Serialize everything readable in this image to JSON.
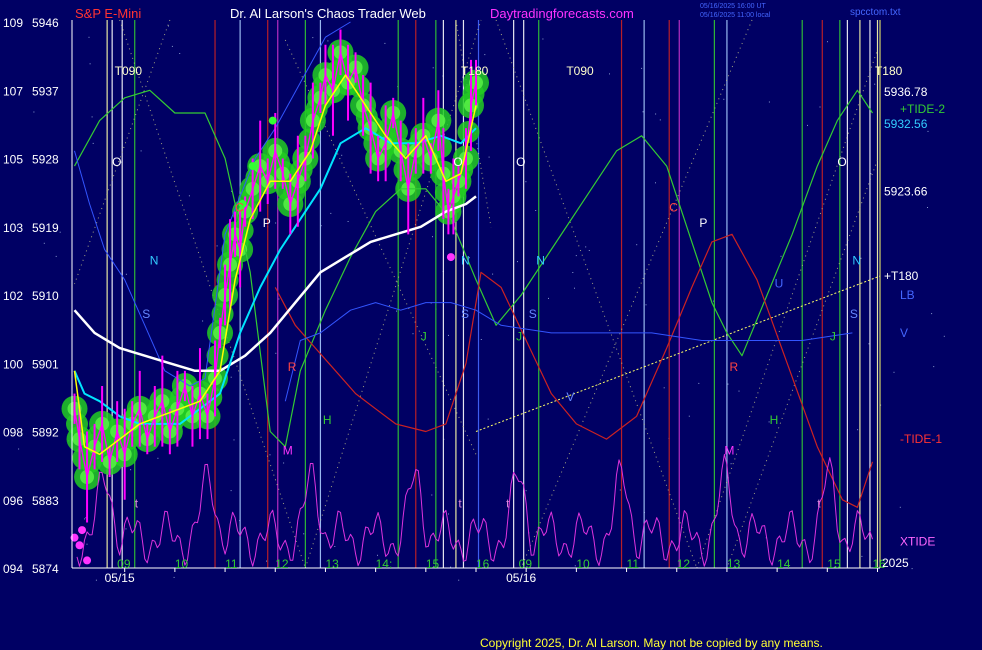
{
  "header": {
    "symbol": "S&P E-Mini",
    "title": "Dr. Al Larson's Chaos Trader Web",
    "site": "Daytradingforecasts.com",
    "timestamp1": "05/16/2025 16:00 UT",
    "timestamp2": "05/16/2025 11:00 local",
    "file": "spcctom.txt"
  },
  "footer": {
    "copyright": "Copyright 2025, Dr. Al Larson. May not be copied by any means."
  },
  "colors": {
    "background": "#000064",
    "price_bars": "#ff00ff",
    "ema_fast": "#ffff00",
    "ema_mid": "#00e5ff",
    "ema_slow": "#ffffff",
    "tide_plus": "#33cc33",
    "tide_minus": "#cc2222",
    "xtide": "#dd33dd",
    "trendline": "#ffff66",
    "glow": "#22cc22"
  },
  "chart_data": {
    "type": "line",
    "y_left_outer": [
      "109",
      "107",
      "105",
      "103",
      "102",
      "100",
      "098",
      "096",
      "094"
    ],
    "y_left_inner": [
      "5946",
      "5937",
      "5928",
      "5919",
      "5910",
      "5901",
      "5892",
      "5883",
      "5874"
    ],
    "ylim": [
      5874,
      5946
    ],
    "x_hour_labels": [
      {
        "t": 8.85,
        "label": "09"
      },
      {
        "t": 10,
        "label": "10"
      },
      {
        "t": 11,
        "label": "11"
      },
      {
        "t": 12,
        "label": "12"
      },
      {
        "t": 13,
        "label": "13"
      },
      {
        "t": 14,
        "label": "14:"
      },
      {
        "t": 15,
        "label": "15"
      },
      {
        "t": 16,
        "label": "16"
      },
      {
        "t": 16.85,
        "label": "09"
      },
      {
        "t": 18,
        "label": "10"
      },
      {
        "t": 19,
        "label": "11"
      },
      {
        "t": 20,
        "label": "12"
      },
      {
        "t": 21,
        "label": "13"
      },
      {
        "t": 22,
        "label": "14"
      },
      {
        "t": 23,
        "label": "15"
      },
      {
        "t": 23.9,
        "label": "16"
      }
    ],
    "x_date_labels": [
      {
        "t": 8.6,
        "label": "05/15"
      },
      {
        "t": 16.6,
        "label": "05/16"
      }
    ],
    "year_label": "2025",
    "price_path": [
      [
        8,
        5895
      ],
      [
        8.1,
        5891
      ],
      [
        8.25,
        5886
      ],
      [
        8.4,
        5890
      ],
      [
        8.55,
        5893
      ],
      [
        8.7,
        5888
      ],
      [
        8.85,
        5892
      ],
      [
        9,
        5889
      ],
      [
        9.15,
        5893
      ],
      [
        9.3,
        5895
      ],
      [
        9.45,
        5891
      ],
      [
        9.6,
        5894
      ],
      [
        9.75,
        5896
      ],
      [
        9.9,
        5892
      ],
      [
        10.05,
        5895
      ],
      [
        10.2,
        5898
      ],
      [
        10.35,
        5894
      ],
      [
        10.5,
        5897
      ],
      [
        10.65,
        5894
      ],
      [
        10.8,
        5899
      ],
      [
        10.9,
        5905
      ],
      [
        11,
        5910
      ],
      [
        11.1,
        5914
      ],
      [
        11.2,
        5918
      ],
      [
        11.3,
        5916
      ],
      [
        11.4,
        5921
      ],
      [
        11.55,
        5924
      ],
      [
        11.7,
        5927
      ],
      [
        11.85,
        5925
      ],
      [
        12,
        5929
      ],
      [
        12.15,
        5926
      ],
      [
        12.3,
        5922
      ],
      [
        12.45,
        5925
      ],
      [
        12.6,
        5928
      ],
      [
        12.75,
        5933
      ],
      [
        12.9,
        5936
      ],
      [
        13,
        5939
      ],
      [
        13.15,
        5937
      ],
      [
        13.3,
        5942
      ],
      [
        13.45,
        5938
      ],
      [
        13.6,
        5940
      ],
      [
        13.75,
        5935
      ],
      [
        13.9,
        5932
      ],
      [
        14.05,
        5928
      ],
      [
        14.2,
        5930
      ],
      [
        14.35,
        5934
      ],
      [
        14.5,
        5929
      ],
      [
        14.65,
        5924
      ],
      [
        14.8,
        5929
      ],
      [
        14.95,
        5931
      ],
      [
        15.1,
        5928
      ],
      [
        15.25,
        5933
      ],
      [
        15.35,
        5926
      ],
      [
        15.45,
        5921
      ],
      [
        15.55,
        5923
      ],
      [
        15.65,
        5925
      ],
      [
        15.8,
        5928
      ],
      [
        15.9,
        5935
      ],
      [
        16,
        5938
      ]
    ],
    "ema_fast": [
      [
        8,
        5900
      ],
      [
        8.2,
        5890
      ],
      [
        8.5,
        5889
      ],
      [
        8.9,
        5891
      ],
      [
        9.3,
        5893
      ],
      [
        9.7,
        5894
      ],
      [
        10.1,
        5895
      ],
      [
        10.5,
        5896
      ],
      [
        10.9,
        5900
      ],
      [
        11.2,
        5912
      ],
      [
        11.5,
        5920
      ],
      [
        11.9,
        5925
      ],
      [
        12.3,
        5925
      ],
      [
        12.7,
        5929
      ],
      [
        13,
        5935
      ],
      [
        13.4,
        5939
      ],
      [
        13.8,
        5935
      ],
      [
        14.2,
        5931
      ],
      [
        14.6,
        5928
      ],
      [
        15,
        5931
      ],
      [
        15.4,
        5925
      ],
      [
        15.7,
        5926
      ],
      [
        16,
        5935
      ]
    ],
    "ema_mid": [
      [
        8,
        5900
      ],
      [
        8.2,
        5897
      ],
      [
        8.5,
        5896
      ],
      [
        8.9,
        5894
      ],
      [
        9.3,
        5893
      ],
      [
        9.7,
        5893
      ],
      [
        10.1,
        5893
      ],
      [
        10.5,
        5895
      ],
      [
        10.9,
        5897
      ],
      [
        11.3,
        5905
      ],
      [
        11.7,
        5911
      ],
      [
        12.1,
        5916
      ],
      [
        12.5,
        5920
      ],
      [
        12.9,
        5924
      ],
      [
        13.3,
        5930
      ],
      [
        13.8,
        5932
      ],
      [
        14.3,
        5930
      ],
      [
        14.8,
        5930
      ],
      [
        15.3,
        5931
      ],
      [
        15.7,
        5930
      ],
      [
        16,
        5932
      ]
    ],
    "ema_slow": [
      [
        8,
        5908
      ],
      [
        8.4,
        5905
      ],
      [
        8.9,
        5903
      ],
      [
        9.4,
        5902
      ],
      [
        9.9,
        5901
      ],
      [
        10.4,
        5900
      ],
      [
        10.9,
        5900
      ],
      [
        11.4,
        5902
      ],
      [
        11.9,
        5905
      ],
      [
        12.4,
        5909
      ],
      [
        12.9,
        5913
      ],
      [
        13.4,
        5915
      ],
      [
        13.9,
        5917
      ],
      [
        14.4,
        5918
      ],
      [
        14.9,
        5919
      ],
      [
        15.4,
        5921
      ],
      [
        15.8,
        5922
      ],
      [
        16,
        5923
      ]
    ],
    "tide_plus": [
      [
        8,
        5927
      ],
      [
        8.5,
        5933
      ],
      [
        9,
        5936
      ],
      [
        9.5,
        5937
      ],
      [
        10,
        5934
      ],
      [
        10.6,
        5934
      ],
      [
        11,
        5928
      ],
      [
        11.5,
        5913
      ],
      [
        11.9,
        5892
      ],
      [
        12.2,
        5890
      ],
      [
        12.5,
        5900
      ],
      [
        13,
        5908
      ],
      [
        13.5,
        5915
      ],
      [
        14,
        5921
      ],
      [
        14.5,
        5924
      ],
      [
        15,
        5924
      ],
      [
        15.5,
        5920
      ],
      [
        16,
        5912
      ],
      [
        16.4,
        5906
      ],
      [
        16.9,
        5910
      ],
      [
        17.5,
        5916
      ],
      [
        18.2,
        5923
      ],
      [
        18.8,
        5929
      ],
      [
        19.3,
        5931
      ],
      [
        19.8,
        5927
      ],
      [
        20.3,
        5917
      ],
      [
        20.7,
        5909
      ],
      [
        21,
        5905
      ],
      [
        21.3,
        5902
      ],
      [
        21.8,
        5910
      ],
      [
        22.3,
        5918
      ],
      [
        22.8,
        5927
      ],
      [
        23.2,
        5933
      ],
      [
        23.6,
        5937
      ],
      [
        23.9,
        5934
      ]
    ],
    "tide_minus": [
      [
        12,
        5911
      ],
      [
        12.4,
        5906
      ],
      [
        12.8,
        5903
      ],
      [
        13.2,
        5900
      ],
      [
        13.6,
        5897
      ],
      [
        14,
        5895
      ],
      [
        14.4,
        5893
      ],
      [
        15,
        5892
      ],
      [
        15.4,
        5893
      ],
      [
        15.8,
        5901
      ],
      [
        16.1,
        5913
      ],
      [
        16.5,
        5911
      ],
      [
        17,
        5904
      ],
      [
        17.5,
        5897
      ],
      [
        18,
        5893
      ],
      [
        18.6,
        5891
      ],
      [
        19.2,
        5894
      ],
      [
        19.8,
        5903
      ],
      [
        20.3,
        5911
      ],
      [
        20.7,
        5917
      ],
      [
        21.1,
        5918
      ],
      [
        21.6,
        5912
      ],
      [
        22.2,
        5901
      ],
      [
        22.8,
        5890
      ],
      [
        23.3,
        5883
      ],
      [
        23.6,
        5882
      ],
      [
        23.9,
        5888
      ]
    ],
    "xtide_seed": 7,
    "right_labels": [
      {
        "label": "5936.78",
        "price": 5936.78
      },
      {
        "label": "+TIDE-2",
        "price": 5934.5
      },
      {
        "label": "5932.56",
        "price": 5932.56
      },
      {
        "label": "5923.66",
        "price": 5923.66
      },
      {
        "label": "+T180",
        "price": 5912.5
      },
      {
        "label": "LB",
        "price": 5910
      },
      {
        "label": "V",
        "price": 5905
      },
      {
        "label": "-TIDE-1",
        "price": 5891
      },
      {
        "label": "XTIDE",
        "price": 5877.5
      }
    ],
    "top_labels": [
      {
        "t": 8.8,
        "label": "T090"
      },
      {
        "t": 15.7,
        "label": "T180"
      },
      {
        "t": 17.8,
        "label": "T090"
      },
      {
        "t": 23.95,
        "label": "T180"
      }
    ],
    "planet_letters": [
      {
        "t": 8.75,
        "p": 5927,
        "label": "O",
        "color": "#ffffff"
      },
      {
        "t": 9.5,
        "p": 5914,
        "label": "N",
        "color": "#33ccff"
      },
      {
        "t": 9.35,
        "p": 5907,
        "label": "S",
        "color": "#6688ff"
      },
      {
        "t": 9.2,
        "p": 5882,
        "label": "t",
        "color": "#dd88dd"
      },
      {
        "t": 11.2,
        "p": 5921,
        "label": "C",
        "color": "#ff4444"
      },
      {
        "t": 11.75,
        "p": 5919,
        "label": "P",
        "color": "#ffffff"
      },
      {
        "t": 12.25,
        "p": 5900,
        "label": "R",
        "color": "#ff4444"
      },
      {
        "t": 12.95,
        "p": 5893,
        "label": "H",
        "color": "#33cc33"
      },
      {
        "t": 12.15,
        "p": 5889,
        "label": "M",
        "color": "#ff33ff"
      },
      {
        "t": 14.9,
        "p": 5904,
        "label": "J",
        "color": "#33cc33"
      },
      {
        "t": 15.7,
        "p": 5907,
        "label": "S",
        "color": "#6688ff"
      },
      {
        "t": 15.55,
        "p": 5927,
        "label": "O",
        "color": "#ffffff"
      },
      {
        "t": 15.7,
        "p": 5914,
        "label": "N",
        "color": "#33ccff"
      },
      {
        "t": 15.65,
        "p": 5882,
        "label": "t",
        "color": "#dd88dd"
      },
      {
        "t": 16.6,
        "p": 5882,
        "label": "t",
        "color": "#dd88dd"
      },
      {
        "t": 16.8,
        "p": 5927,
        "label": "O",
        "color": "#ffffff"
      },
      {
        "t": 17.2,
        "p": 5914,
        "label": "N",
        "color": "#33ccff"
      },
      {
        "t": 17.05,
        "p": 5907,
        "label": "S",
        "color": "#6688ff"
      },
      {
        "t": 16.8,
        "p": 5904,
        "label": "J",
        "color": "#33cc33"
      },
      {
        "t": 17.8,
        "p": 5896,
        "label": "V",
        "color": "#6688ff"
      },
      {
        "t": 19.85,
        "p": 5921,
        "label": "C",
        "color": "#ff4444"
      },
      {
        "t": 20.45,
        "p": 5919,
        "label": "P",
        "color": "#ffffff"
      },
      {
        "t": 21.05,
        "p": 5900,
        "label": "R",
        "color": "#ff4444"
      },
      {
        "t": 21.95,
        "p": 5911,
        "label": "U",
        "color": "#4466ff"
      },
      {
        "t": 21.85,
        "p": 5893,
        "label": "H",
        "color": "#33cc33"
      },
      {
        "t": 20.95,
        "p": 5889,
        "label": "M",
        "color": "#ff33ff"
      },
      {
        "t": 23.2,
        "p": 5927,
        "label": "O",
        "color": "#ffffff"
      },
      {
        "t": 23.5,
        "p": 5914,
        "label": "N",
        "color": "#33ccff"
      },
      {
        "t": 23.45,
        "p": 5907,
        "label": "S",
        "color": "#6688ff"
      },
      {
        "t": 23.05,
        "p": 5904,
        "label": "J",
        "color": "#33cc33"
      },
      {
        "t": 22.8,
        "p": 5882,
        "label": "t",
        "color": "#dd88dd"
      }
    ],
    "vertical_lines": [
      {
        "t": 8.65,
        "color": "#ffffaa"
      },
      {
        "t": 8.75,
        "color": "#ffffff"
      },
      {
        "t": 8.95,
        "color": "#ffffff"
      },
      {
        "t": 9.2,
        "color": "#33cc33"
      },
      {
        "t": 10.8,
        "color": "#cc2222"
      },
      {
        "t": 11.3,
        "color": "#aaccff"
      },
      {
        "t": 11.85,
        "color": "#cc2222"
      },
      {
        "t": 12.05,
        "color": "#cc33cc"
      },
      {
        "t": 12.6,
        "color": "#33cc33"
      },
      {
        "t": 12.9,
        "color": "#aaccff"
      },
      {
        "t": 14.45,
        "color": "#33cc33"
      },
      {
        "t": 14.8,
        "color": "#cc2222"
      },
      {
        "t": 15.2,
        "color": "#33cc33"
      },
      {
        "t": 15.35,
        "color": "#ffffff"
      },
      {
        "t": 15.6,
        "color": "#ffffaa"
      },
      {
        "t": 15.75,
        "color": "#ffffff"
      },
      {
        "t": 16.05,
        "color": "#4466ff"
      },
      {
        "t": 16.75,
        "color": "#ffffff"
      },
      {
        "t": 16.95,
        "color": "#ffffff"
      },
      {
        "t": 17.25,
        "color": "#33cc33"
      },
      {
        "t": 18.9,
        "color": "#cc2222"
      },
      {
        "t": 19.35,
        "color": "#aaccff"
      },
      {
        "t": 19.85,
        "color": "#cc2222"
      },
      {
        "t": 20.05,
        "color": "#cc33cc"
      },
      {
        "t": 20.75,
        "color": "#33cc33"
      },
      {
        "t": 21.0,
        "color": "#aaccff"
      },
      {
        "t": 22.5,
        "color": "#33cc33"
      },
      {
        "t": 22.9,
        "color": "#cc2222"
      },
      {
        "t": 23.25,
        "color": "#33cc33"
      },
      {
        "t": 23.4,
        "color": "#ffffff"
      },
      {
        "t": 23.65,
        "color": "#ffffaa"
      },
      {
        "t": 23.85,
        "color": "#ffffff"
      },
      {
        "t": 24.0,
        "color": "#ffffaa"
      }
    ],
    "grid": false
  }
}
